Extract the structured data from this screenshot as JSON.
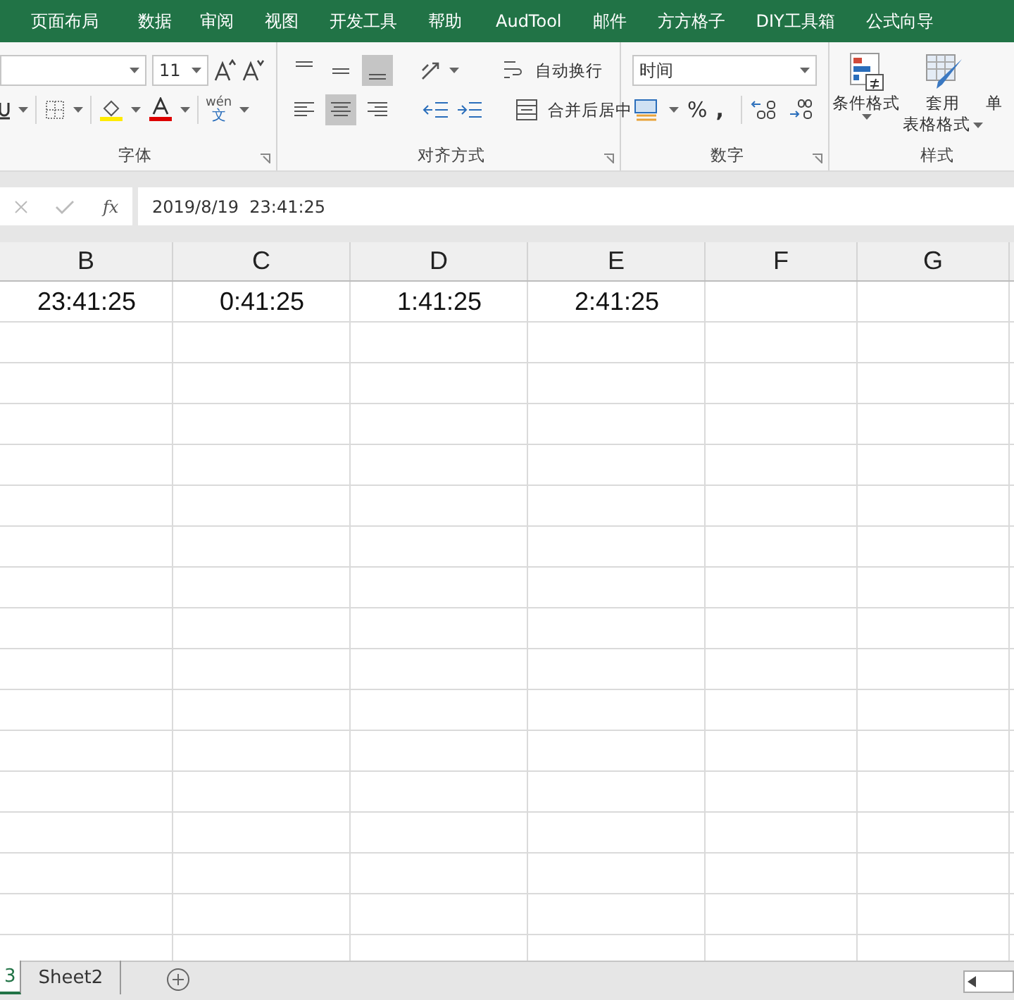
{
  "menu_tabs": [
    "页面布局",
    "数据",
    "审阅",
    "视图",
    "开发工具",
    "帮助",
    "AudTool",
    "邮件",
    "方方格子",
    "DIY工具箱",
    "公式向导"
  ],
  "ribbon": {
    "font": {
      "size": "11",
      "phonetic_top": "wén",
      "phonetic_bottom": "文",
      "label": "字体"
    },
    "alignment": {
      "vertical": [
        {
          "kind": "top",
          "selected": false
        },
        {
          "kind": "middle",
          "selected": false
        },
        {
          "kind": "bottom",
          "selected": true
        }
      ],
      "horizontal": [
        {
          "kind": "left",
          "selected": false
        },
        {
          "kind": "center",
          "selected": true
        },
        {
          "kind": "right",
          "selected": false
        }
      ],
      "wrap_text": "自动换行",
      "merge": "合并后居中",
      "label": "对齐方式"
    },
    "number": {
      "format": "时间",
      "percent": "%",
      "comma": ",",
      "label": "数字"
    },
    "styles": {
      "conditional": "条件格式",
      "table_format_1": "套用",
      "table_format_2": "表格格式",
      "cell_styles": "单",
      "label": "样式"
    }
  },
  "formula_bar": {
    "function_label": "fx",
    "value": "2019/8/19  23:41:25"
  },
  "columns": [
    "B",
    "C",
    "D",
    "E",
    "F",
    "G"
  ],
  "rows": [
    [
      "23:41:25",
      "0:41:25",
      "1:41:25",
      "2:41:25",
      "",
      ""
    ]
  ],
  "sheet_tabs": [
    {
      "label": "3",
      "selected": true
    },
    {
      "label": "Sheet2",
      "selected": false
    }
  ]
}
